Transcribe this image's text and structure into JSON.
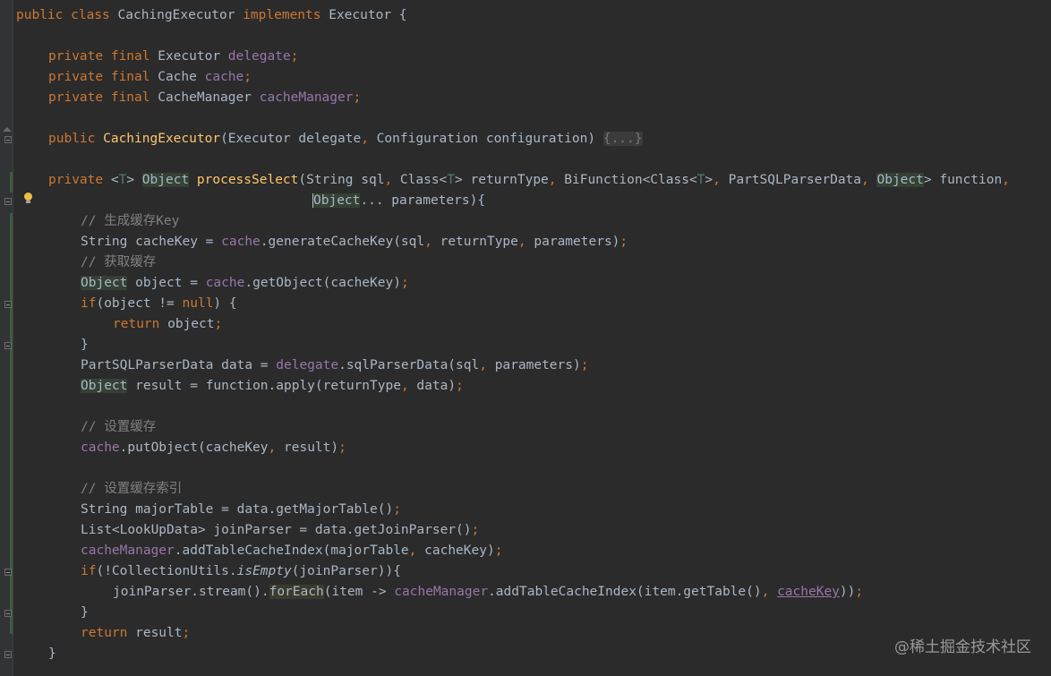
{
  "editor": {
    "lines": {
      "l0": [
        "public class ",
        "CachingExecutor ",
        "implements ",
        "Executor {"
      ],
      "l2": [
        "private final ",
        "Executor ",
        "delegate",
        ";"
      ],
      "l3": [
        "private final ",
        "Cache ",
        "cache",
        ";"
      ],
      "l4": [
        "private final ",
        "CacheManager ",
        "cacheManager",
        ";"
      ],
      "l6": [
        "public ",
        "CachingExecutor",
        "(Executor delegate",
        ", ",
        "Configuration configuration) ",
        "{...}"
      ],
      "l8": [
        "private ",
        "<",
        "T",
        "> ",
        "Object",
        " ",
        "processSelect",
        "(String sql",
        ", ",
        "Class<",
        "T",
        "> returnType",
        ", ",
        "BiFunction<Class<",
        "T",
        ">",
        ", ",
        "PartSQLParserData",
        ", ",
        "Object",
        "> function",
        ","
      ],
      "l9": [
        "Object",
        "... parameters){"
      ],
      "l10": [
        "// 生成缓存Key"
      ],
      "l11": [
        "String cacheKey = ",
        "cache",
        ".generateCacheKey(sql",
        ", ",
        "returnType",
        ", ",
        "parameters)",
        ";"
      ],
      "l12": [
        "// 获取缓存"
      ],
      "l13": [
        "Object",
        " object = ",
        "cache",
        ".getObject(cacheKey)",
        ";"
      ],
      "l14": [
        "if",
        "(object != ",
        "null",
        ") {"
      ],
      "l15": [
        "return ",
        "object",
        ";"
      ],
      "l16": [
        "}"
      ],
      "l17": [
        "PartSQLParserData data = ",
        "delegate",
        ".sqlParserData(sql",
        ", ",
        "parameters)",
        ";"
      ],
      "l18": [
        "Object",
        " result = function.apply(returnType",
        ", ",
        "data)",
        ";"
      ],
      "l20": [
        "// 设置缓存"
      ],
      "l21": [
        "cache",
        ".putObject(cacheKey",
        ", ",
        "result)",
        ";"
      ],
      "l23": [
        "// 设置缓存索引"
      ],
      "l24": [
        "String majorTable = data.getMajorTable()",
        ";"
      ],
      "l25": [
        "List<LookUpData> joinParser = data.getJoinParser()",
        ";"
      ],
      "l26": [
        "cacheManager",
        ".addTableCacheIndex(majorTable",
        ", ",
        "cacheKey)",
        ";"
      ],
      "l27": [
        "if",
        "(!CollectionUtils.",
        "isEmpty",
        "(joinParser)){"
      ],
      "l28": [
        "joinParser.stream().",
        "forEach",
        "(item -> ",
        "cacheManager",
        ".addTableCacheIndex(item.getTable()",
        ", ",
        "cacheKey",
        "))",
        ";"
      ],
      "l29": [
        "}"
      ],
      "l30": [
        "return ",
        "result",
        ";"
      ],
      "l31": [
        "}"
      ]
    }
  },
  "icons": {
    "intention": "lightbulb-icon",
    "fold": "fold-marker-icon"
  },
  "colors": {
    "background": "#2b2b2b",
    "keyword": "#cc7832",
    "field": "#9876aa",
    "method": "#ffc66d",
    "comment": "#808080",
    "type_param": "#507874",
    "text": "#a9b7c6"
  },
  "watermark": "@稀土掘金技术社区"
}
